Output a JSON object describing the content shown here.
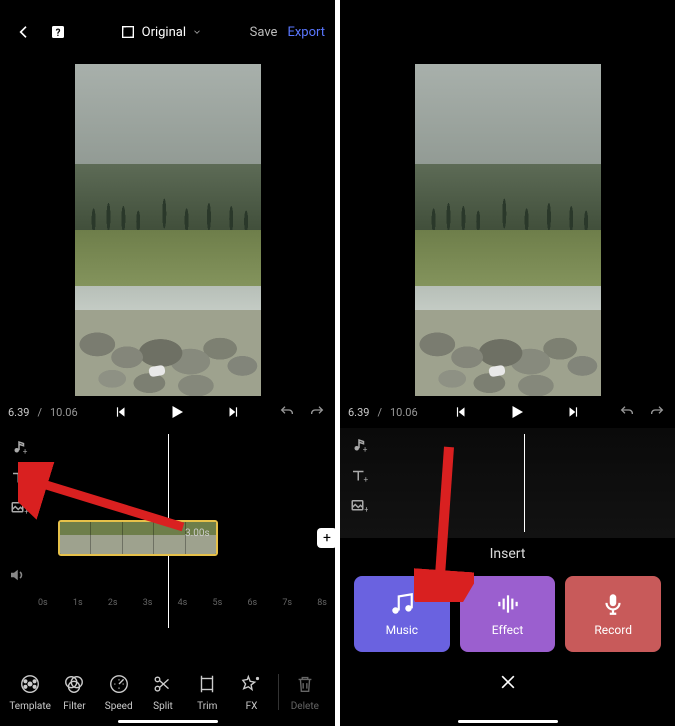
{
  "left": {
    "topbar": {
      "aspect_label": "Original",
      "save_label": "Save",
      "export_label": "Export"
    },
    "playback": {
      "current": "6.39",
      "separator": "/",
      "total": "10.06"
    },
    "clip_duration": "3.00s",
    "ruler": [
      "0s",
      "1s",
      "2s",
      "3s",
      "4s",
      "5s",
      "6s",
      "7s",
      "8s"
    ],
    "toolbar": {
      "template": "Template",
      "filter": "Filter",
      "speed": "Speed",
      "split": "Split",
      "trim": "Trim",
      "fx": "FX",
      "delete": "Delete"
    }
  },
  "right": {
    "playback": {
      "current": "6.39",
      "separator": "/",
      "total": "10.06"
    },
    "insert": {
      "title": "Insert",
      "music": "Music",
      "effect": "Effect",
      "record": "Record"
    }
  }
}
